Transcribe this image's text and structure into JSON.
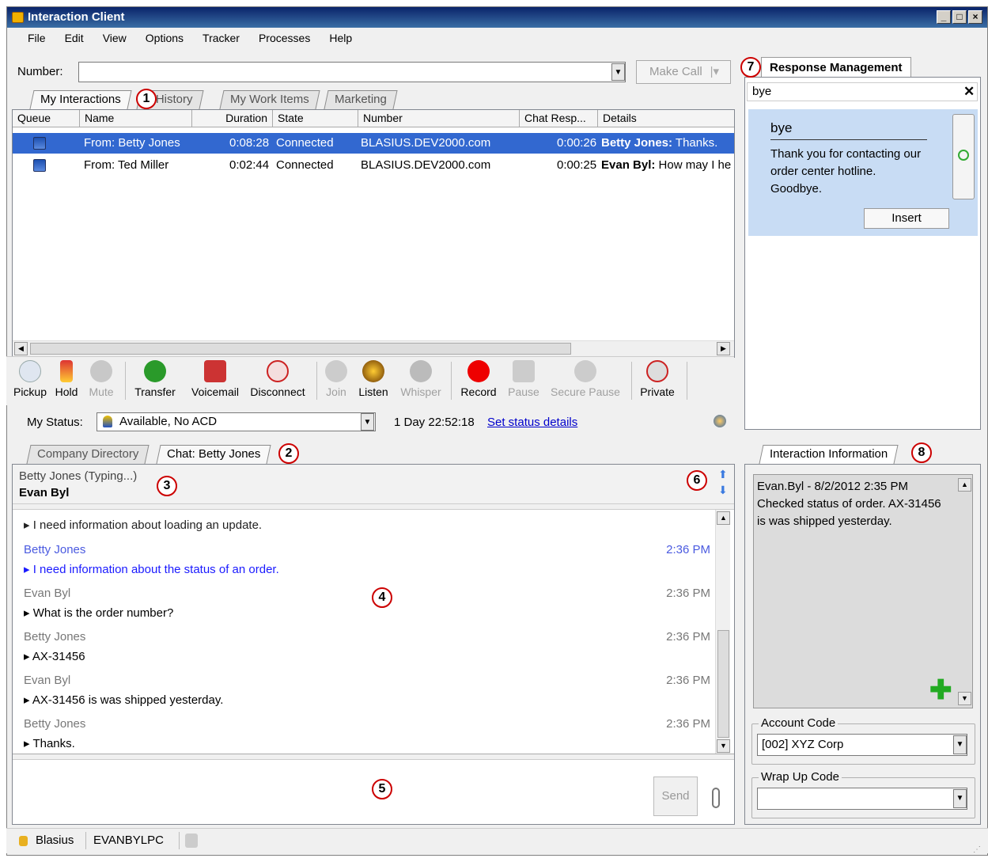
{
  "window": {
    "title": "Interaction Client"
  },
  "menu": [
    "File",
    "Edit",
    "View",
    "Options",
    "Tracker",
    "Processes",
    "Help"
  ],
  "number": {
    "label": "Number:",
    "value": "",
    "make_call": "Make Call"
  },
  "tabs_top": [
    "My Interactions",
    "ll History",
    "My Work Items",
    "Marketing"
  ],
  "columns": [
    "Queue",
    "Name",
    "Duration",
    "State",
    "Number",
    "Chat Resp...",
    "Details"
  ],
  "rows": [
    {
      "name": "From: Betty Jones",
      "duration": "0:08:28",
      "state": "Connected",
      "number": "BLASIUS.DEV2000.com",
      "chat_resp": "0:00:26",
      "details_bold": "Betty Jones:",
      "details": " Thanks."
    },
    {
      "name": "From: Ted Miller",
      "duration": "0:02:44",
      "state": "Connected",
      "number": "BLASIUS.DEV2000.com",
      "chat_resp": "0:00:25",
      "details_bold": "Evan Byl:",
      "details": " How may I he"
    }
  ],
  "toolbar": [
    "Pickup",
    "Hold",
    "Mute",
    "Transfer",
    "Voicemail",
    "Disconnect",
    "Join",
    "Listen",
    "Whisper",
    "Record",
    "Pause",
    "Secure Pause",
    "Private"
  ],
  "status": {
    "label": "My Status:",
    "value": "Available, No ACD",
    "time": "1 Day 22:52:18",
    "link": "Set status details"
  },
  "tabs_bottom": [
    "Company Directory",
    "Chat: Betty Jones"
  ],
  "chat_header": {
    "typing": "Betty Jones (Typing...)",
    "agent": "Evan Byl"
  },
  "messages": [
    {
      "name": "",
      "time": "",
      "text": "I need information about loading an update.",
      "blue": false
    },
    {
      "name": "Betty Jones",
      "time": "2:36 PM",
      "text": "I need information about the status of an order.",
      "blue": true
    },
    {
      "name": "Evan Byl",
      "time": "2:36 PM",
      "text": "What is the order number?",
      "blue": false
    },
    {
      "name": "Betty Jones",
      "time": "2:36 PM",
      "text": "AX-31456",
      "blue": false
    },
    {
      "name": "Evan Byl",
      "time": "2:36 PM",
      "text": "AX-31456 is was shipped yesterday.",
      "blue": false
    },
    {
      "name": "Betty Jones",
      "time": "2:36 PM",
      "text": "Thanks.",
      "blue": false
    }
  ],
  "send_label": "Send",
  "callouts": [
    "1",
    "2",
    "3",
    "4",
    "5",
    "6",
    "7",
    "8"
  ],
  "response": {
    "tab": "Response Management",
    "search": "bye",
    "title": "bye",
    "body": "Thank you for contacting our order center hotline. Goodbye.",
    "insert": "Insert"
  },
  "info": {
    "tab": "Interaction Information",
    "note": "Evan.Byl - 8/2/2012 2:35 PM\nChecked status of order. AX-31456 is was shipped yesterday.",
    "account_label": "Account Code",
    "account_value": "[002]  XYZ Corp",
    "wrap_label": "Wrap Up Code",
    "wrap_value": ""
  },
  "statusbar": {
    "server": "Blasius",
    "station": "EVANBYLPC"
  }
}
